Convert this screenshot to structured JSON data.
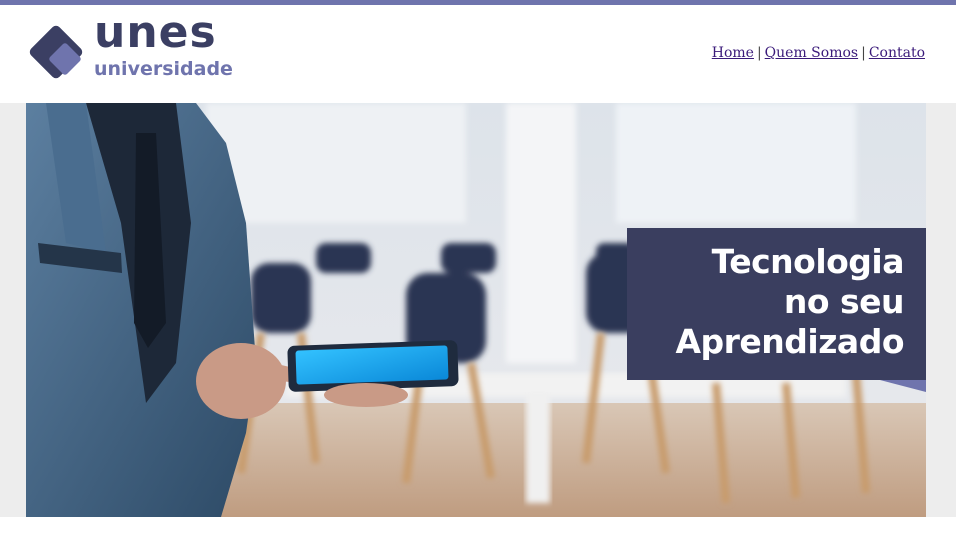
{
  "brand": {
    "name": "unes",
    "subtitle": "universidade",
    "colors": {
      "primary": "#3b3f63",
      "accent": "#6f74ad",
      "link": "#3a1a7a"
    }
  },
  "nav": {
    "items": [
      {
        "label": "Home"
      },
      {
        "label": "Quem Somos"
      },
      {
        "label": "Contato"
      }
    ],
    "separator": "|"
  },
  "banner": {
    "tagline": [
      "Tecnologia",
      "no seu",
      "Aprendizado"
    ],
    "image": "man-in-suit-holding-tablet-in-office"
  }
}
